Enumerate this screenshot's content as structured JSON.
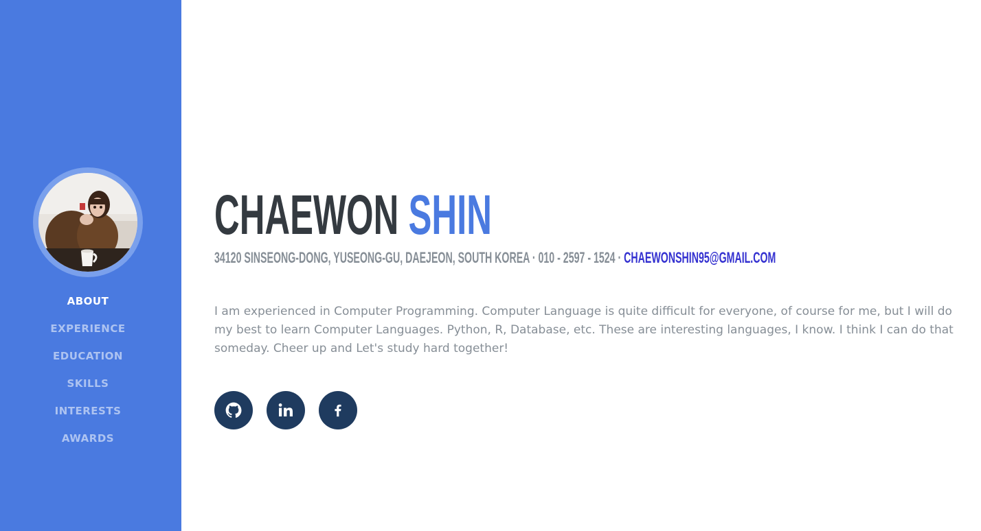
{
  "profile": {
    "first_name": "CHAEWON",
    "last_name": "SHIN",
    "address": "34120 SINSEONG-DONG, YUSEONG-GU, DAEJEON, SOUTH KOREA",
    "separator_1": " · ",
    "phone": "010 - 2597 - 1524",
    "separator_2": " · ",
    "email": "CHAEWONSHIN95@GMAIL.COM",
    "about": "I am experienced in Computer Programming. Computer Language is quite difficult for everyone, of course for me, but I will do my best to learn Computer Languages. Python, R, Database, etc. These are interesting languages, I know. I think I can do that someday. Cheer up and Let's study hard together!"
  },
  "nav": {
    "items": [
      {
        "label": "ABOUT"
      },
      {
        "label": "EXPERIENCE"
      },
      {
        "label": "EDUCATION"
      },
      {
        "label": "SKILLS"
      },
      {
        "label": "INTERESTS"
      },
      {
        "label": "AWARDS"
      }
    ],
    "active": "ABOUT"
  },
  "socials": [
    {
      "icon": "github-icon"
    },
    {
      "icon": "linkedin-icon"
    },
    {
      "icon": "facebook-icon"
    }
  ],
  "colors": {
    "sidebar": "#4a7ae0",
    "accent": "#4a7ae0",
    "heading": "#343a40",
    "muted": "#868e96",
    "link": "#3431d0",
    "social_bg": "#1f3b5f"
  }
}
